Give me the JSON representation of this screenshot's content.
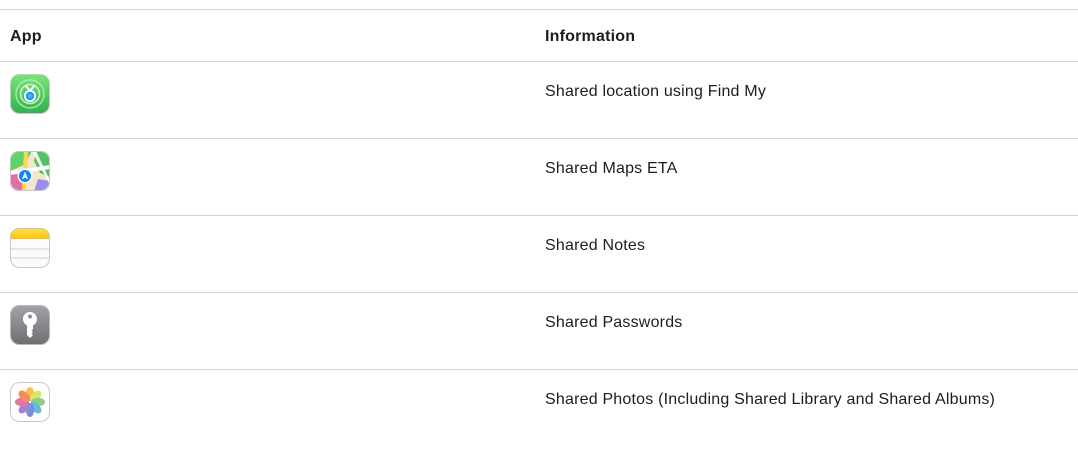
{
  "table": {
    "headers": {
      "app": "App",
      "information": "Information"
    },
    "rows": [
      {
        "icon": "find-my-icon",
        "information": "Shared location using Find My"
      },
      {
        "icon": "maps-icon",
        "information": "Shared Maps ETA"
      },
      {
        "icon": "notes-icon",
        "information": "Shared Notes"
      },
      {
        "icon": "passwords-icon",
        "information": "Shared Passwords"
      },
      {
        "icon": "photos-icon",
        "information": "Shared Photos (Including Shared Library and Shared Albums)"
      }
    ]
  },
  "colors": {
    "divider": "#d2d2d7",
    "text": "#1d1d1f",
    "find_my_green": "#34c759",
    "notes_yellow": "#ffcc00",
    "passwords_gray": "#8e8e93"
  }
}
